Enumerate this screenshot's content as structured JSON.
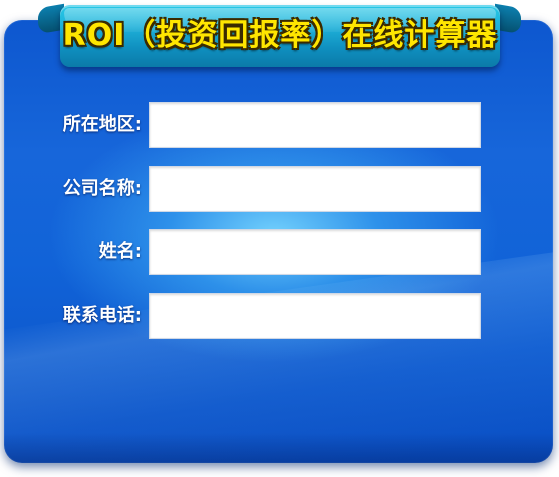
{
  "window": {
    "title": "ROI（投资回报率）在线计算器"
  },
  "colors": {
    "panel": "#1163d8",
    "panel_glow": "#78d7ff",
    "ribbon": "#1fb1d9",
    "title_text": "#ffe600",
    "label_text": "#ffffff",
    "input_bg": "#ffffff"
  },
  "form": {
    "fields": [
      {
        "label": "所在地区:",
        "value": "",
        "placeholder": ""
      },
      {
        "label": "公司名称:",
        "value": "",
        "placeholder": ""
      },
      {
        "label": "姓名:",
        "value": "",
        "placeholder": ""
      },
      {
        "label": "联系电话:",
        "value": "",
        "placeholder": ""
      }
    ]
  }
}
